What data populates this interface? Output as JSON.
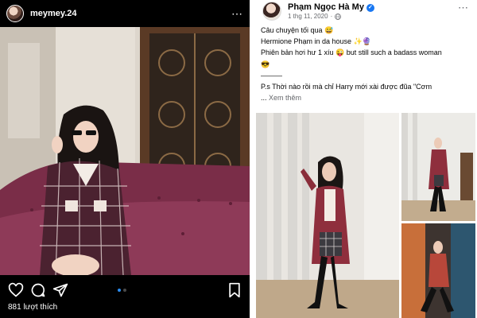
{
  "instagram": {
    "username": "meymey.24",
    "more_icon": "⋯",
    "likes": "881 lượt thích",
    "carousel": {
      "count": 2,
      "active_index": 0
    },
    "icons": [
      "heart-icon",
      "comment-icon",
      "share-icon",
      "bookmark-icon"
    ],
    "colors": {
      "background": "#000000",
      "carousel_active": "#2a8cf0"
    }
  },
  "facebook": {
    "author": "Phạm Ngọc Hà My",
    "verified_icon": "✓",
    "date": "1 thg 11, 2020",
    "dot": "·",
    "more_icon": "⋯",
    "post_lines": [
      "Câu chuyện tối qua 😅",
      "Hermione Phạm in da house ✨🔮",
      "Phiên bản hơi hư 1 xíu 😜 but still such a badass woman",
      "😎",
      "———",
      "P.s Thời nào rồi mà chỉ Harry mới xài được đũa \"Cơm"
    ],
    "ellipsis": "...",
    "see_more": "Xem thêm",
    "colors": {
      "verified": "#1877f2",
      "muted": "#65676b",
      "text": "#050505"
    }
  }
}
